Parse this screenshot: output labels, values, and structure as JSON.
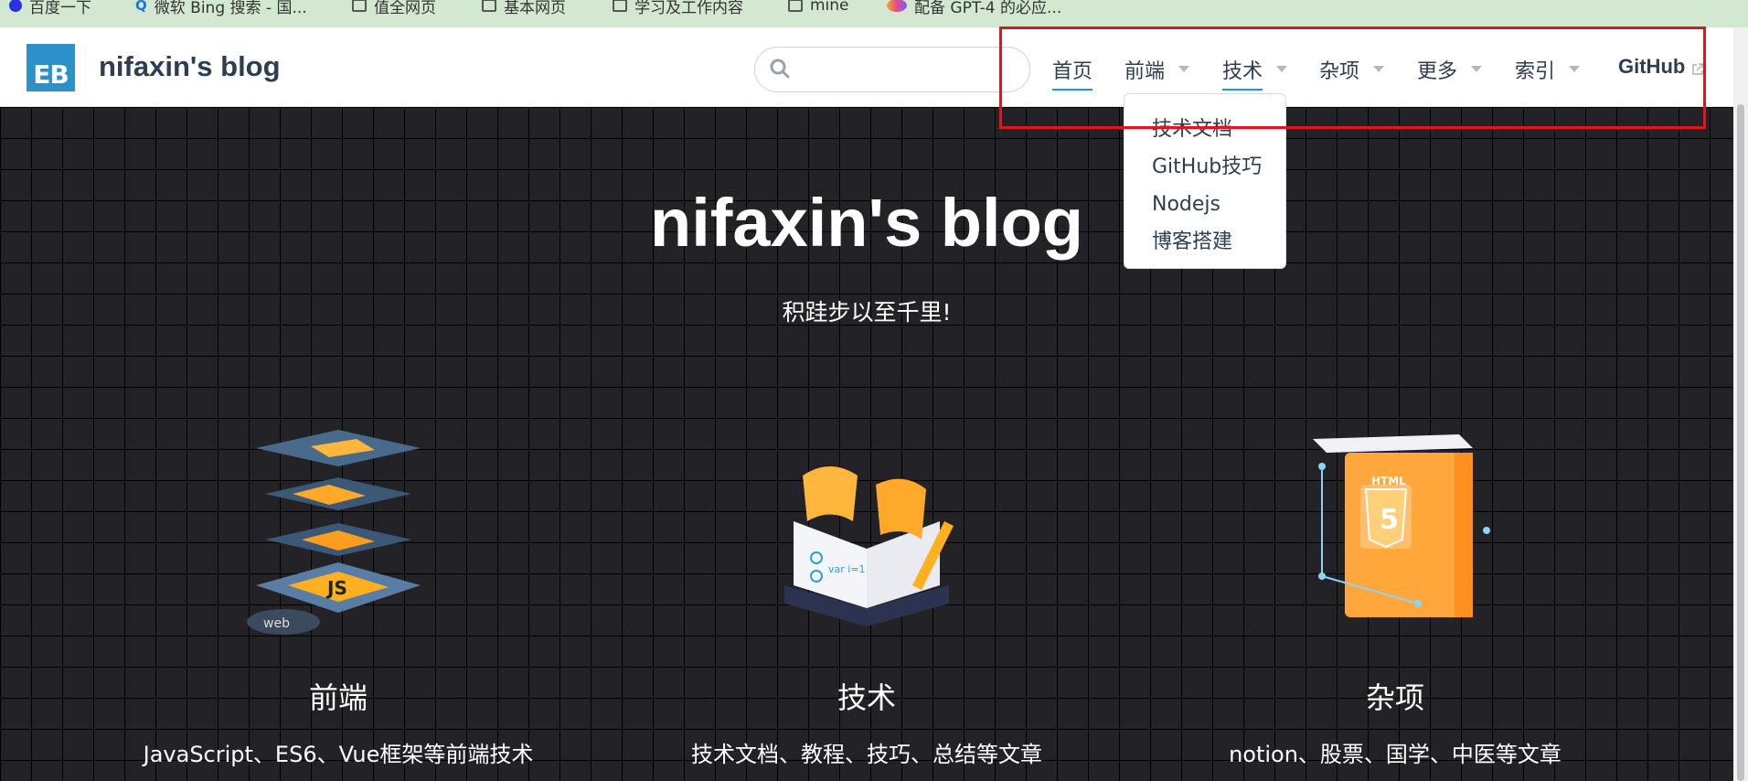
{
  "bookmarks": [
    {
      "label": "百度一下",
      "icon": "baidu-icon"
    },
    {
      "label": "微软 Bing 搜索 - 国...",
      "icon": "bing-icon"
    },
    {
      "label": "值全网页",
      "icon": "folder-icon"
    },
    {
      "label": "基本网页",
      "icon": "folder-icon"
    },
    {
      "label": "学习及工作内容",
      "icon": "folder-icon"
    },
    {
      "label": "mine",
      "icon": "folder-icon"
    },
    {
      "label": "配备 GPT-4 的必应...",
      "icon": "copilot-icon"
    }
  ],
  "header": {
    "logo_text": "EB",
    "site_name": "nifaxin's blog",
    "search_placeholder": "",
    "nav": [
      {
        "label": "首页",
        "has_caret": false
      },
      {
        "label": "前端",
        "has_caret": true
      },
      {
        "label": "技术",
        "has_caret": true
      },
      {
        "label": "杂项",
        "has_caret": true
      },
      {
        "label": "更多",
        "has_caret": true
      },
      {
        "label": "索引",
        "has_caret": true
      },
      {
        "label": "GitHub",
        "has_caret": false
      }
    ]
  },
  "dropdown": {
    "items": [
      "技术文档",
      "GitHub技巧",
      "Nodejs",
      "博客搭建"
    ]
  },
  "hero": {
    "title": "nifaxin's blog",
    "subtitle": "积跬步以至千里!"
  },
  "features": [
    {
      "title": "前端",
      "desc": "JavaScript、ES6、Vue框架等前端技术",
      "art_text": "web"
    },
    {
      "title": "技术",
      "desc": "技术文档、教程、技巧、总结等文章",
      "art_text": "var i=1"
    },
    {
      "title": "杂项",
      "desc": "notion、股票、国学、中医等文章",
      "art_text": "HTML"
    }
  ],
  "colors": {
    "accent": "#1d9bd1",
    "annotation": "#e3141b",
    "hero_bg": "#232227"
  }
}
